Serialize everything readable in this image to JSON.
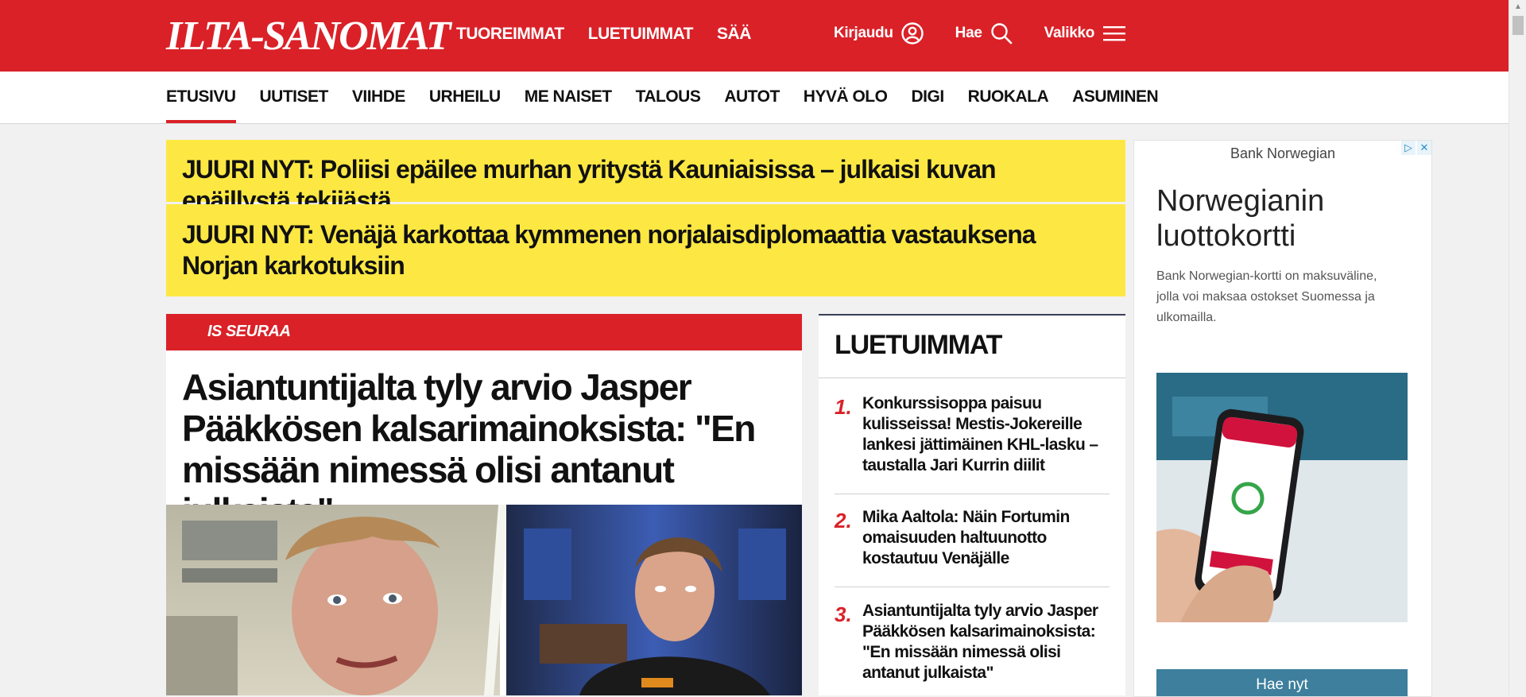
{
  "header": {
    "logo": "ILTA-SANOMAT",
    "nav": [
      "TUOREIMMAT",
      "LUETUIMMAT",
      "SÄÄ"
    ],
    "login_label": "Kirjaudu",
    "search_label": "Hae",
    "menu_label": "Valikko",
    "brand_color": "#da2128"
  },
  "sections": {
    "items": [
      "ETUSIVU",
      "UUTISET",
      "VIIHDE",
      "URHEILU",
      "ME NAISET",
      "TALOUS",
      "AUTOT",
      "HYVÄ OLO",
      "DIGI",
      "RUOKALA",
      "ASUMINEN"
    ],
    "active": "ETUSIVU"
  },
  "breaking": [
    "JUURI NYT: Poliisi epäilee murhan yritystä Kauniaisissa – julkaisi kuvan epäillystä tekijästä",
    "JUURI NYT: Venäjä karkottaa kymmenen norjalaisdiplomaattia vastauksena Norjan karkotuksiin"
  ],
  "main_article": {
    "tag": "IS SEURAA",
    "title": "Asiantuntijalta tyly arvio Jasper Pääkkösen kalsarimainoksista: \"En missään nimessä olisi antanut julkaista\""
  },
  "popular": {
    "title": "LUETUIMMAT",
    "items": [
      {
        "num": "1.",
        "text": "Konkurssisoppa paisuu kulisseissa! Mestis-Jokereille lankesi jättimäinen KHL-lasku – taustalla Jari Kurrin diilit"
      },
      {
        "num": "2.",
        "text": "Mika Aaltola: Näin Fortumin omaisuuden haltuunotto kostautuu Venäjälle"
      },
      {
        "num": "3.",
        "text": "Asiantuntijalta tyly arvio Jasper Pääkkösen kalsarimainoksista: \"En missään nimessä olisi antanut julkaista\""
      }
    ]
  },
  "ad": {
    "brand": "Bank Norwegian",
    "title": "Norwegianin luottokortti",
    "text": "Bank Norwegian-kortti on maksuväline, jolla voi maksaa ostokset Suomessa ja ulkomailla.",
    "button": "Hae nyt",
    "button_color": "#3d7f9c"
  }
}
